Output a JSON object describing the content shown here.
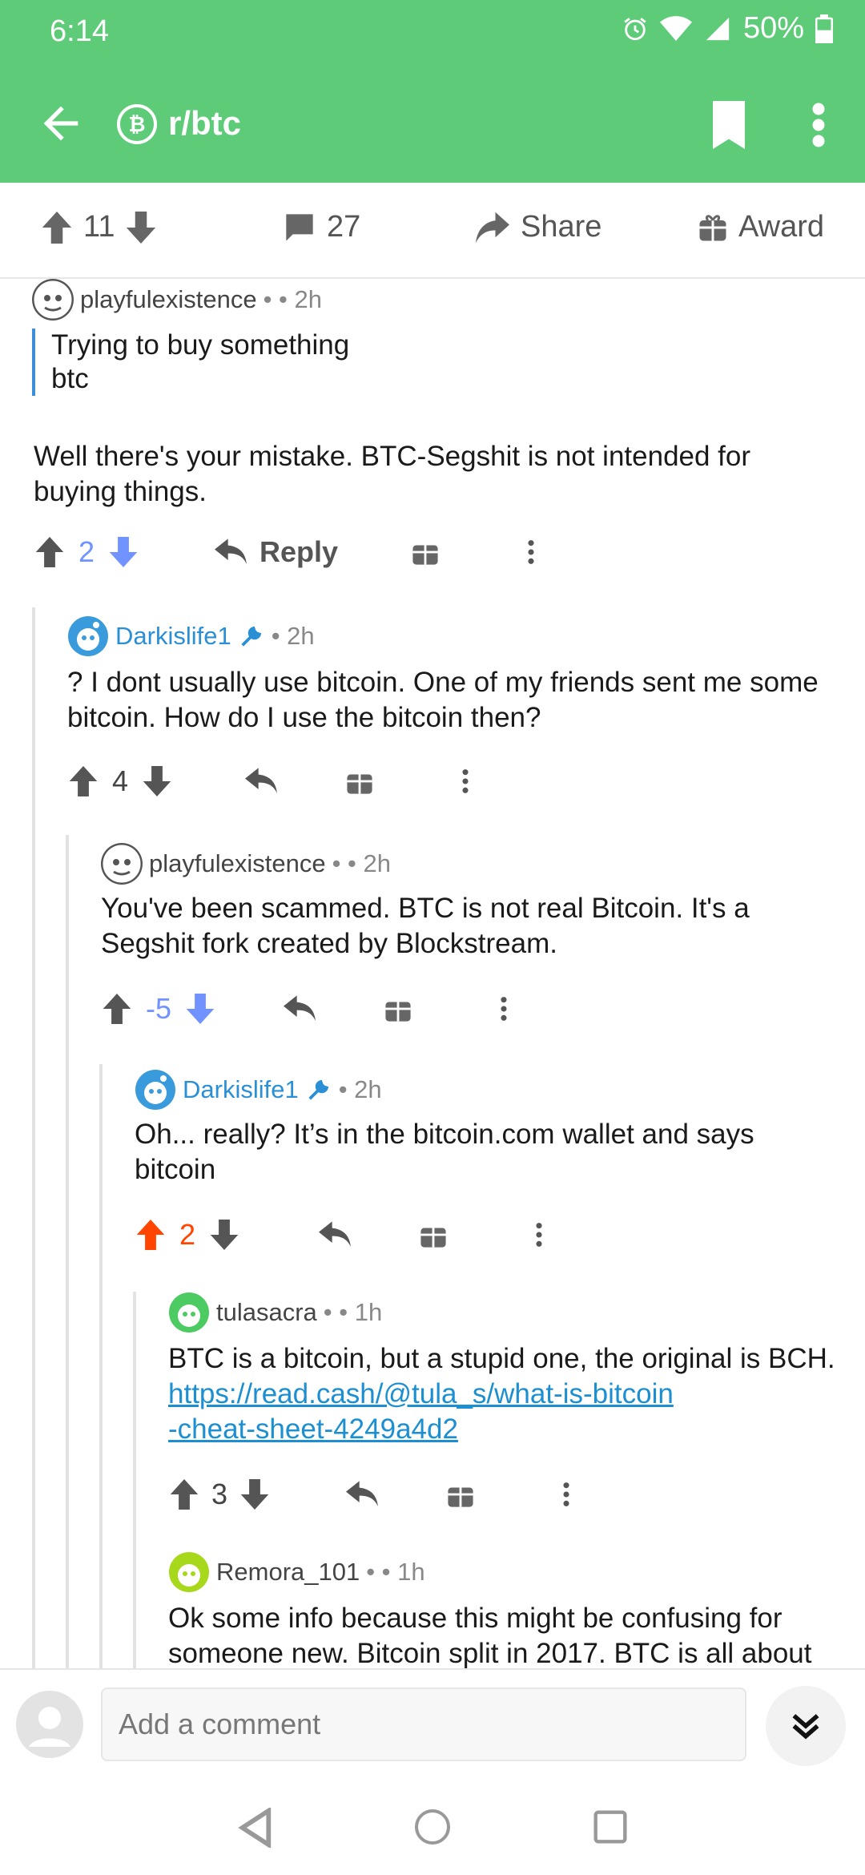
{
  "status": {
    "time": "6:14",
    "battery": "50%"
  },
  "toolbar": {
    "subreddit": "r/btc",
    "sub_icon_glyph": "₿",
    "back_icon": "arrow-left-icon",
    "bookmark_icon": "bookmark-icon",
    "more_icon": "more-vert-icon"
  },
  "post_actions": {
    "score": "11",
    "comments": "27",
    "share": "Share",
    "award": "Award"
  },
  "comments": [
    {
      "author": "playfulexistence",
      "meta": "• • 2h",
      "quote_line1": "Trying to buy something",
      "quote_line2": "btc",
      "body": "Well there's your mistake. BTC-Segshit is not intended for buying things.",
      "score": "2",
      "reply": "Reply",
      "vote_state": "down"
    },
    {
      "author": "Darkislife1",
      "meta": "• 2h",
      "body": "? I dont usually use bitcoin. One of my friends sent me some bitcoin. How do I use the bitcoin then?",
      "score": "4"
    },
    {
      "author": "playfulexistence",
      "meta": "• • 2h",
      "body": "You've been scammed. BTC is not real Bitcoin. It's a Segshit fork created by Blockstream.",
      "score": "-5",
      "vote_state": "down"
    },
    {
      "author": "Darkislife1",
      "meta": "• 2h",
      "body": "Oh... really? It’s in the bitcoin.com wallet and says bitcoin",
      "score": "2",
      "vote_state": "up"
    },
    {
      "author": "tulasacra",
      "meta": "• • 1h",
      "body_prefix": "BTC is a bitcoin, but a stupid one, the original is BCH. ",
      "link_line1": "https://read.cash/@tula_s/what-is-bitcoin",
      "link_line2": "-cheat-sheet-4249a4d2",
      "score": "3"
    },
    {
      "author": "Remora_101",
      "meta": "• • 1h",
      "body": "Ok some info because this might be confusing for someone new. Bitcoin split in 2017. BTC is all about"
    }
  ],
  "composer": {
    "placeholder": "Add a comment"
  },
  "colors": {
    "brand_green": "#5ecb79",
    "upvote": "#ff4500",
    "downvote": "#7193ff",
    "link": "#1b8fd1"
  }
}
